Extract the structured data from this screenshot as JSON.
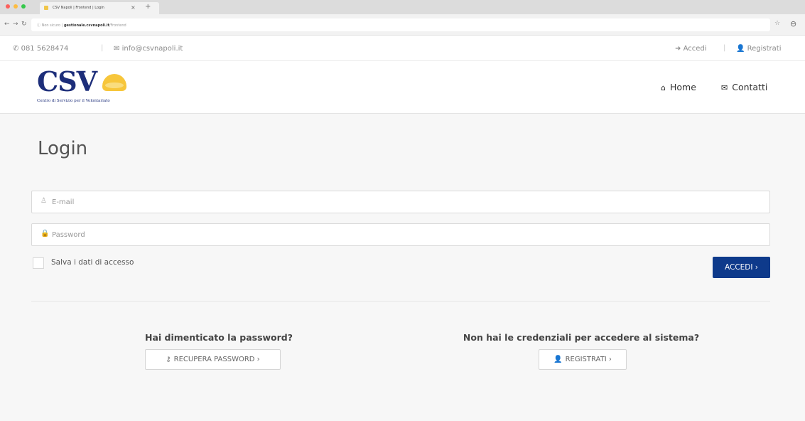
{
  "browser": {
    "tab_title": "CSV Napoli | Frontend | Login",
    "tab_close": "×",
    "new_tab": "+",
    "url_security": "Non sicuro",
    "url_host": "gestionale.csvnapoli.it",
    "url_path": "/Frontend",
    "traffic_colors": [
      "#fc605c",
      "#fdbc40",
      "#34c84a"
    ]
  },
  "topbar": {
    "phone": "081 5628474",
    "email": "info@csvnapoli.it",
    "login_link": "Accedi",
    "register_link": "Registrati"
  },
  "header": {
    "logo_text": "CSV",
    "logo_badge": "Napoli",
    "logo_tagline": "Centro di Servizio per il Volontariato",
    "nav": [
      {
        "label": "Home",
        "icon": "home-icon"
      },
      {
        "label": "Contatti",
        "icon": "envelope-icon"
      }
    ]
  },
  "login": {
    "title": "Login",
    "email_placeholder": "E-mail",
    "password_placeholder": "Password",
    "remember_label": "Salva i dati di accesso",
    "submit_label": "ACCEDI ›"
  },
  "recover": {
    "question": "Hai dimenticato la password?",
    "button_label": "RECUPERA PASSWORD ›"
  },
  "register": {
    "question": "Non hai le credenziali per accedere al sistema?",
    "button_label": "REGISTRATI ›"
  },
  "colors": {
    "brand_blue": "#1d2e7a",
    "button_blue": "#0e3a8b",
    "logo_yellow": "#f7c63b",
    "page_background": "#f7f7f7"
  }
}
